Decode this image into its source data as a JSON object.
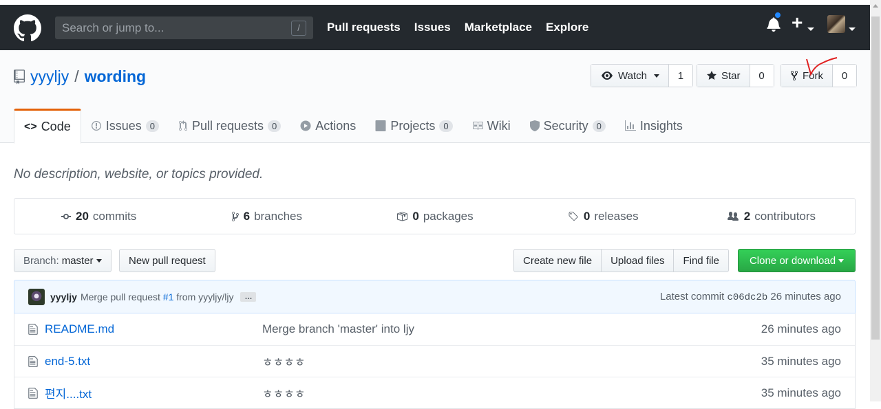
{
  "header": {
    "search_placeholder": "Search or jump to...",
    "search_hotkey": "/",
    "nav": [
      "Pull requests",
      "Issues",
      "Marketplace",
      "Explore"
    ],
    "plus": "+"
  },
  "repo": {
    "owner": "yyyljy",
    "separator": "/",
    "name": "wording",
    "watch_label": "Watch",
    "watch_count": "1",
    "star_label": "Star",
    "star_count": "0",
    "fork_label": "Fork",
    "fork_count": "0"
  },
  "tabs": [
    {
      "label": "Code",
      "count": ""
    },
    {
      "label": "Issues",
      "count": "0"
    },
    {
      "label": "Pull requests",
      "count": "0"
    },
    {
      "label": "Actions",
      "count": ""
    },
    {
      "label": "Projects",
      "count": "0"
    },
    {
      "label": "Wiki",
      "count": ""
    },
    {
      "label": "Security",
      "count": "0"
    },
    {
      "label": "Insights",
      "count": ""
    }
  ],
  "description": "No description, website, or topics provided.",
  "summary": {
    "commits_num": "20",
    "commits_label": "commits",
    "branches_num": "6",
    "branches_label": "branches",
    "packages_num": "0",
    "packages_label": "packages",
    "releases_num": "0",
    "releases_label": "releases",
    "contributors_num": "2",
    "contributors_label": "contributors"
  },
  "toolbar": {
    "branch_prefix": "Branch:",
    "branch_name": "master",
    "new_pr": "New pull request",
    "create_file": "Create new file",
    "upload_files": "Upload files",
    "find_file": "Find file",
    "clone": "Clone or download"
  },
  "commit": {
    "author": "yyyljy",
    "msg_prefix": "Merge pull request",
    "pr_link": "#1",
    "msg_suffix": "from yyyljy/ljy",
    "ellipsis": "…",
    "latest_label": "Latest commit",
    "sha": "c06dc2b",
    "age": "26 minutes ago"
  },
  "files": [
    {
      "name": "README.md",
      "message": "Merge branch 'master' into ljy",
      "age": "26 minutes ago"
    },
    {
      "name": "end-5.txt",
      "message": "ㅎㅎㅎㅎ",
      "age": "35 minutes ago"
    },
    {
      "name": "편지....txt",
      "message": "ㅎㅎㅎㅎ",
      "age": "35 minutes ago"
    }
  ],
  "colors": {
    "accent_tab": "#e36209",
    "link": "#0366d6",
    "clone_green": "#28a745",
    "header_bg": "#24292e"
  }
}
